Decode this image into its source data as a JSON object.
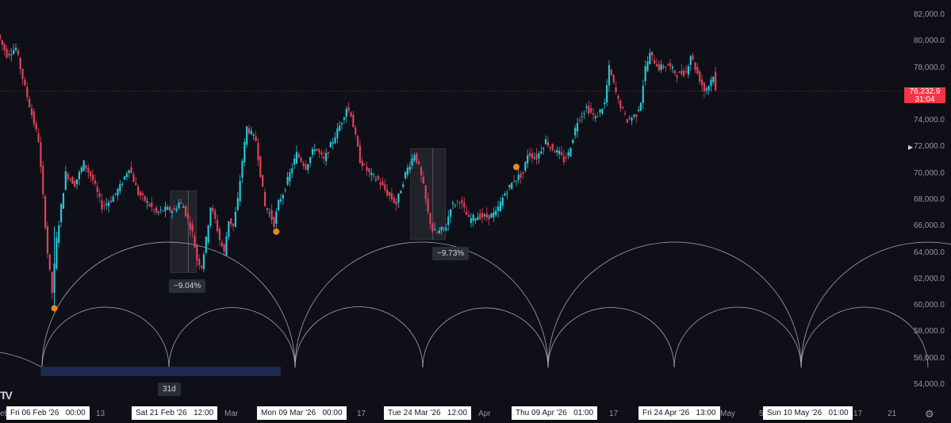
{
  "chart_data": {
    "type": "candlestick",
    "y_axis": {
      "ylim": [
        52500,
        83000
      ],
      "tick_labels": [
        "82,000.0",
        "80,000.0",
        "78,000.0",
        "76,000.0",
        "74,000.0",
        "72,000.0",
        "70,000.0",
        "68,000.0",
        "66,000.0",
        "64,000.0",
        "62,000.0",
        "60,000.0",
        "58,000.0",
        "56,000.0",
        "54,000.0"
      ],
      "tick_values": [
        82000,
        80000,
        78000,
        76000,
        74000,
        72000,
        70000,
        68000,
        66000,
        64000,
        62000,
        60000,
        58000,
        56000,
        54000
      ]
    },
    "last_price": {
      "value": 76232.9,
      "label": "76,232.9",
      "countdown": "31:04",
      "color": "#f23645"
    },
    "x_axis": {
      "labels": [
        "eb",
        "13",
        "Mar",
        "17",
        "Apr",
        "17",
        "May",
        "5",
        "17",
        "21"
      ],
      "highlighted_dates": [
        "Fri 06 Feb '26   00:00",
        "Sat 21 Feb '26   12:00",
        "Mon 09 Mar '26   00:00",
        "Tue 24 Mar '26   12:00",
        "Thu 09 Apr '26   01:00",
        "Fri 24 Apr '26   13:00",
        "Sun 10 May '26   01:00"
      ]
    },
    "price_path": [
      {
        "t": 0,
        "p": 80500
      },
      {
        "t": 2,
        "p": 79000
      },
      {
        "t": 4,
        "p": 79500
      },
      {
        "t": 6,
        "p": 76500
      },
      {
        "t": 9,
        "p": 72500
      },
      {
        "t": 11,
        "p": 64000
      },
      {
        "t": 12,
        "p": 61000
      },
      {
        "t": 13,
        "p": 65000
      },
      {
        "t": 15,
        "p": 70000
      },
      {
        "t": 17,
        "p": 69200
      },
      {
        "t": 19,
        "p": 70800
      },
      {
        "t": 21,
        "p": 69500
      },
      {
        "t": 23,
        "p": 67500
      },
      {
        "t": 25,
        "p": 68000
      },
      {
        "t": 27,
        "p": 69000
      },
      {
        "t": 29,
        "p": 70500
      },
      {
        "t": 31,
        "p": 68500
      },
      {
        "t": 33,
        "p": 67800
      },
      {
        "t": 35,
        "p": 67000
      },
      {
        "t": 37,
        "p": 67300
      },
      {
        "t": 39,
        "p": 67200
      },
      {
        "t": 40,
        "p": 67800
      },
      {
        "t": 41,
        "p": 67500
      },
      {
        "t": 43,
        "p": 65500
      },
      {
        "t": 44,
        "p": 63500
      },
      {
        "t": 45,
        "p": 63000
      },
      {
        "t": 46,
        "p": 65000
      },
      {
        "t": 47,
        "p": 67500
      },
      {
        "t": 48,
        "p": 66500
      },
      {
        "t": 49,
        "p": 65000
      },
      {
        "t": 50,
        "p": 64000
      },
      {
        "t": 51,
        "p": 66500
      },
      {
        "t": 52,
        "p": 66000
      },
      {
        "t": 53,
        "p": 68000
      },
      {
        "t": 54,
        "p": 71000
      },
      {
        "t": 55,
        "p": 73500
      },
      {
        "t": 57,
        "p": 72500
      },
      {
        "t": 59,
        "p": 67500
      },
      {
        "t": 60,
        "p": 67000
      },
      {
        "t": 61,
        "p": 66200
      },
      {
        "t": 62,
        "p": 67800
      },
      {
        "t": 63,
        "p": 68500
      },
      {
        "t": 64,
        "p": 69500
      },
      {
        "t": 66,
        "p": 71500
      },
      {
        "t": 68,
        "p": 70500
      },
      {
        "t": 70,
        "p": 72000
      },
      {
        "t": 72,
        "p": 71000
      },
      {
        "t": 74,
        "p": 72500
      },
      {
        "t": 76,
        "p": 74000
      },
      {
        "t": 77,
        "p": 75000
      },
      {
        "t": 78,
        "p": 74500
      },
      {
        "t": 80,
        "p": 71000
      },
      {
        "t": 82,
        "p": 70000
      },
      {
        "t": 84,
        "p": 69500
      },
      {
        "t": 86,
        "p": 68500
      },
      {
        "t": 88,
        "p": 67700
      },
      {
        "t": 90,
        "p": 70000
      },
      {
        "t": 92,
        "p": 71500
      },
      {
        "t": 93,
        "p": 70500
      },
      {
        "t": 94,
        "p": 69000
      },
      {
        "t": 95,
        "p": 67000
      },
      {
        "t": 96,
        "p": 65700
      },
      {
        "t": 97,
        "p": 65500
      },
      {
        "t": 99,
        "p": 66000
      },
      {
        "t": 100,
        "p": 67500
      },
      {
        "t": 102,
        "p": 68000
      },
      {
        "t": 104,
        "p": 66500
      },
      {
        "t": 106,
        "p": 66800
      },
      {
        "t": 108,
        "p": 66700
      },
      {
        "t": 110,
        "p": 67000
      },
      {
        "t": 112,
        "p": 68500
      },
      {
        "t": 114,
        "p": 69500
      },
      {
        "t": 116,
        "p": 70000
      },
      {
        "t": 117,
        "p": 71500
      },
      {
        "t": 119,
        "p": 71200
      },
      {
        "t": 121,
        "p": 72500
      },
      {
        "t": 122,
        "p": 72000
      },
      {
        "t": 124,
        "p": 71500
      },
      {
        "t": 125,
        "p": 71000
      },
      {
        "t": 126,
        "p": 71500
      },
      {
        "t": 128,
        "p": 74000
      },
      {
        "t": 130,
        "p": 75000
      },
      {
        "t": 132,
        "p": 74200
      },
      {
        "t": 134,
        "p": 75300
      },
      {
        "t": 135,
        "p": 78000
      },
      {
        "t": 137,
        "p": 75500
      },
      {
        "t": 139,
        "p": 74000
      },
      {
        "t": 141,
        "p": 74500
      },
      {
        "t": 142,
        "p": 75500
      },
      {
        "t": 143,
        "p": 78000
      },
      {
        "t": 144,
        "p": 79000
      },
      {
        "t": 146,
        "p": 78000
      },
      {
        "t": 148,
        "p": 78200
      },
      {
        "t": 150,
        "p": 77500
      },
      {
        "t": 152,
        "p": 77700
      },
      {
        "t": 153,
        "p": 79000
      },
      {
        "t": 154,
        "p": 78000
      },
      {
        "t": 156,
        "p": 76300
      },
      {
        "t": 157,
        "p": 76700
      },
      {
        "t": 158,
        "p": 77500
      },
      {
        "t": 158.5,
        "p": 76233
      }
    ],
    "time_domain": [
      0,
      158.5
    ],
    "pivot_markers": [
      {
        "t": 12,
        "p": 59800
      },
      {
        "t": 61,
        "p": 65600
      },
      {
        "t": 114,
        "p": 70500
      }
    ],
    "measure_boxes": [
      {
        "t0": 38,
        "t1": 42,
        "p0": 68700,
        "p1": 62500,
        "label": "−9.04%"
      },
      {
        "t0": 91,
        "t1": 97,
        "p0": 71900,
        "p1": 65000,
        "label": "−9.73%"
      }
    ],
    "range_bar": {
      "t0": 9,
      "t1": 62,
      "label": "31d"
    },
    "title": "",
    "xlabel": "",
    "ylabel": ""
  }
}
